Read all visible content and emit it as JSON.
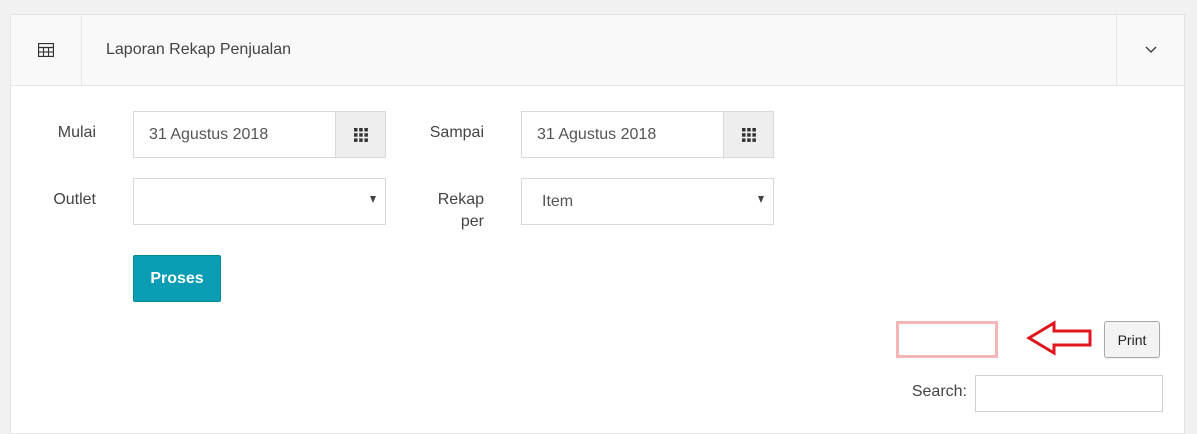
{
  "header": {
    "title": "Laporan Rekap Penjualan",
    "icon": "table-icon",
    "collapse_icon": "chevron-down-icon"
  },
  "form": {
    "mulai": {
      "label": "Mulai",
      "value": "31 Agustus 2018",
      "icon": "calendar-grid-icon"
    },
    "sampai": {
      "label": "Sampai",
      "value": "31 Agustus 2018",
      "icon": "calendar-grid-icon"
    },
    "outlet": {
      "label": "Outlet",
      "value": ""
    },
    "rekap_per": {
      "label_line1": "Rekap",
      "label_line2": "per",
      "value": "Item"
    },
    "proses_label": "Proses"
  },
  "toolbar": {
    "print_label": "Print",
    "search_label": "Search:",
    "search_value": ""
  },
  "colors": {
    "primary_button": "#0a9db3",
    "annotation_red": "#e0161c",
    "highlight_box": "#f4b6b6"
  }
}
